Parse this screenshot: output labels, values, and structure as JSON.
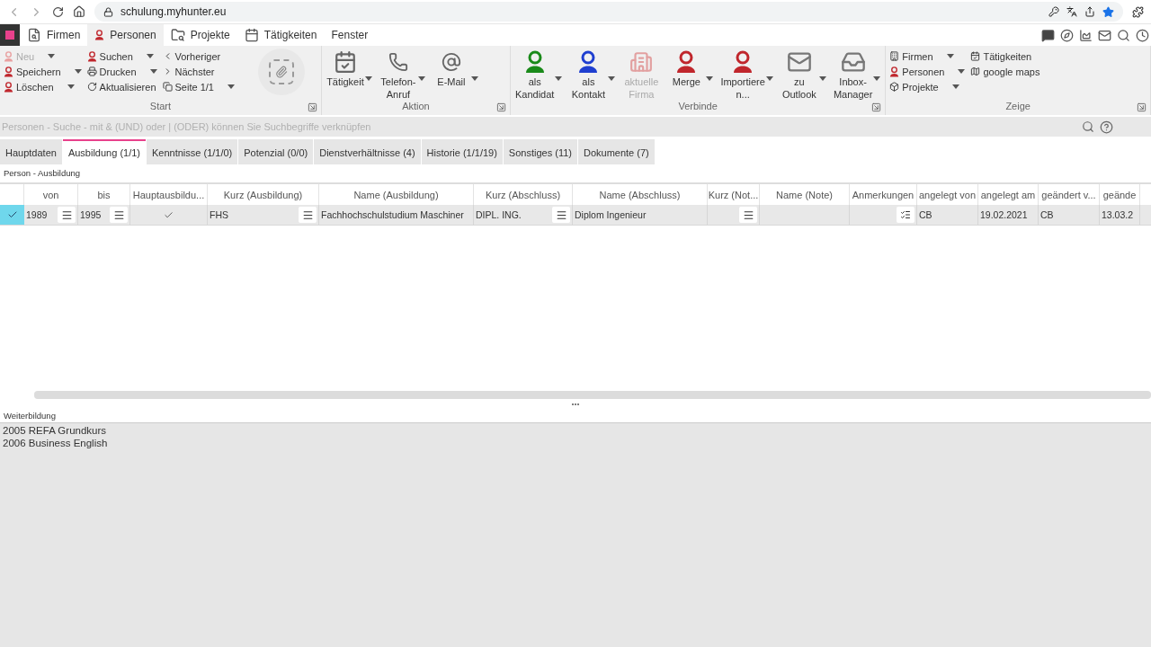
{
  "browser": {
    "url": "schulung.myhunter.eu"
  },
  "menu": {
    "tabs": [
      {
        "label": "Firmen",
        "selected": false
      },
      {
        "label": "Personen",
        "selected": true
      },
      {
        "label": "Projekte",
        "selected": false
      },
      {
        "label": "Tätigkeiten",
        "selected": false
      },
      {
        "label": "Fenster",
        "selected": false
      }
    ]
  },
  "ribbon": {
    "groups": [
      {
        "title": "Start",
        "items": [
          {
            "kind": "stack",
            "items": [
              {
                "label": "Neu",
                "dropdown": true,
                "disabled": true
              },
              {
                "label": "Speichern",
                "dropdown": true,
                "disabled": false
              },
              {
                "label": "Löschen",
                "dropdown": true,
                "disabled": false
              }
            ]
          },
          {
            "kind": "stack",
            "items": [
              {
                "label": "Suchen",
                "dropdown": true,
                "disabled": false
              },
              {
                "label": "Drucken",
                "dropdown": true,
                "disabled": false
              },
              {
                "label": "Aktualisieren",
                "dropdown": false,
                "disabled": false
              }
            ]
          },
          {
            "kind": "stack",
            "items": [
              {
                "label": "Vorheriger",
                "dropdown": false,
                "disabled": false
              },
              {
                "label": "Nächster",
                "dropdown": false,
                "disabled": false
              },
              {
                "label": "Seite 1/1",
                "dropdown": true,
                "disabled": false
              }
            ]
          },
          {
            "kind": "attach"
          }
        ]
      },
      {
        "title": "Aktion",
        "items": [
          {
            "kind": "large",
            "lines": [
              "Tätigkeit"
            ],
            "dropdown": true,
            "disabled": false
          },
          {
            "kind": "large",
            "lines": [
              "Telefon-",
              "Anruf"
            ],
            "dropdown": true,
            "disabled": false
          },
          {
            "kind": "large",
            "lines": [
              "E-Mail"
            ],
            "dropdown": true,
            "disabled": false
          }
        ]
      },
      {
        "title": "Verbinde",
        "items": [
          {
            "kind": "large",
            "lines": [
              "als",
              "Kandidat"
            ],
            "dropdown": true,
            "disabled": false
          },
          {
            "kind": "large",
            "lines": [
              "als",
              "Kontakt"
            ],
            "dropdown": true,
            "disabled": false
          },
          {
            "kind": "large",
            "lines": [
              "aktuelle",
              "Firma"
            ],
            "dropdown": false,
            "disabled": true
          },
          {
            "kind": "large",
            "lines": [
              "Merge"
            ],
            "dropdown": true,
            "disabled": false
          },
          {
            "kind": "large",
            "lines": [
              "Importiere",
              "n..."
            ],
            "dropdown": true,
            "disabled": false
          },
          {
            "kind": "large",
            "lines": [
              "zu",
              "Outlook"
            ],
            "dropdown": true,
            "disabled": false
          },
          {
            "kind": "large",
            "lines": [
              "Inbox-",
              "Manager"
            ],
            "dropdown": true,
            "disabled": false
          }
        ]
      },
      {
        "title": "Zeige",
        "items": [
          {
            "kind": "stack",
            "items": [
              {
                "label": "Firmen",
                "dropdown": true,
                "disabled": false
              },
              {
                "label": "Personen",
                "dropdown": true,
                "disabled": false
              },
              {
                "label": "Projekte",
                "dropdown": true,
                "disabled": false
              }
            ]
          },
          {
            "kind": "stack",
            "items": [
              {
                "label": "Tätigkeiten",
                "dropdown": false,
                "disabled": false
              },
              {
                "label": "google maps",
                "dropdown": false,
                "disabled": false
              }
            ]
          }
        ]
      }
    ]
  },
  "search": {
    "placeholder": "Personen - Suche - mit & (UND) oder | (ODER) können Sie Suchbegriffe verknüpfen"
  },
  "tabs": [
    {
      "label": "Hauptdaten",
      "selected": false
    },
    {
      "label": "Ausbildung (1/1)",
      "selected": true
    },
    {
      "label": "Kenntnisse (1/1/0)",
      "selected": false
    },
    {
      "label": "Potenzial (0/0)",
      "selected": false
    },
    {
      "label": "Dienstverhältnisse (4)",
      "selected": false
    },
    {
      "label": "Historie (1/1/19)",
      "selected": false
    },
    {
      "label": "Sonstiges (11)",
      "selected": false
    },
    {
      "label": "Dokumente (7)",
      "selected": false
    }
  ],
  "section_title": "Person - Ausbildung",
  "table": {
    "columns": [
      "von",
      "bis",
      "Hauptausbildu...",
      "Kurz (Ausbildung)",
      "Name (Ausbildung)",
      "Kurz (Abschluss)",
      "Name (Abschluss)",
      "Kurz (Not...",
      "Name (Note)",
      "Anmerkungen",
      "angelegt von",
      "angelegt am",
      "geändert v...",
      "geände"
    ],
    "rows": [
      {
        "selected": true,
        "cells": [
          {
            "kind": "text",
            "text": "1989",
            "menu": true
          },
          {
            "kind": "text",
            "text": "1995",
            "menu": true
          },
          {
            "kind": "check",
            "checked": true
          },
          {
            "kind": "text",
            "text": "FHS",
            "menu": true
          },
          {
            "kind": "text",
            "text": "Fachhochschulstudium Maschiner"
          },
          {
            "kind": "text",
            "text": "DIPL. ING.",
            "menu": true
          },
          {
            "kind": "text",
            "text": "Diplom Ingenieur"
          },
          {
            "kind": "text",
            "menu": true
          },
          {
            "kind": "text"
          },
          {
            "kind": "notes"
          },
          {
            "kind": "text",
            "text": "CB"
          },
          {
            "kind": "text",
            "text": "19.02.2021"
          },
          {
            "kind": "text",
            "text": "CB"
          },
          {
            "kind": "text",
            "text": "13.03.2"
          }
        ]
      }
    ]
  },
  "weiterbildung": {
    "title": "Weiterbildung",
    "lines": [
      "2005 REFA Grundkurs",
      "2006 Business English"
    ]
  }
}
